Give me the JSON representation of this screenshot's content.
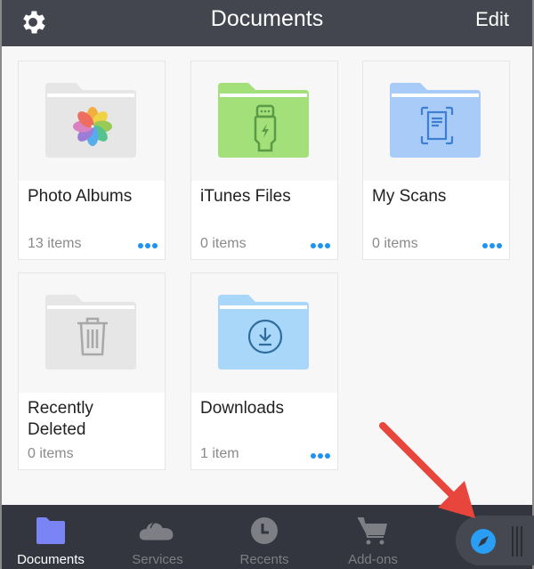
{
  "navbar": {
    "title": "Documents",
    "edit_label": "Edit",
    "settings_icon": "gear-icon"
  },
  "folders": [
    {
      "title": "Photo Albums",
      "count": "13 items",
      "icon": "photos-flower-icon",
      "color": "#e8e8e8",
      "has_more": true
    },
    {
      "title": "iTunes Files",
      "count": "0 items",
      "icon": "usb-cable-icon",
      "color": "#a3e07a",
      "has_more": true
    },
    {
      "title": "My Scans",
      "count": "0 items",
      "icon": "scan-document-icon",
      "color": "#a8cbf7",
      "has_more": true
    },
    {
      "title": "Recently Deleted",
      "count": "0 items",
      "icon": "trash-icon",
      "color": "#e8e8e8",
      "has_more": false
    },
    {
      "title": "Downloads",
      "count": "1 item",
      "icon": "download-circle-icon",
      "color": "#a8d7f9",
      "has_more": true
    }
  ],
  "tabbar": {
    "tabs": [
      {
        "label": "Documents",
        "icon": "folder-icon",
        "active": true
      },
      {
        "label": "Services",
        "icon": "cloud-icon",
        "active": false
      },
      {
        "label": "Recents",
        "icon": "clock-icon",
        "active": false
      },
      {
        "label": "Add-ons",
        "icon": "cart-icon",
        "active": false
      }
    ],
    "browser_button_icon": "compass-icon"
  },
  "colors": {
    "navbar_bg": "#43464e",
    "tabbar_bg": "#33363e",
    "accent_blue": "#1e93f2",
    "active_tab_icon": "#7b84f5",
    "annotation_arrow": "#e8453c"
  }
}
